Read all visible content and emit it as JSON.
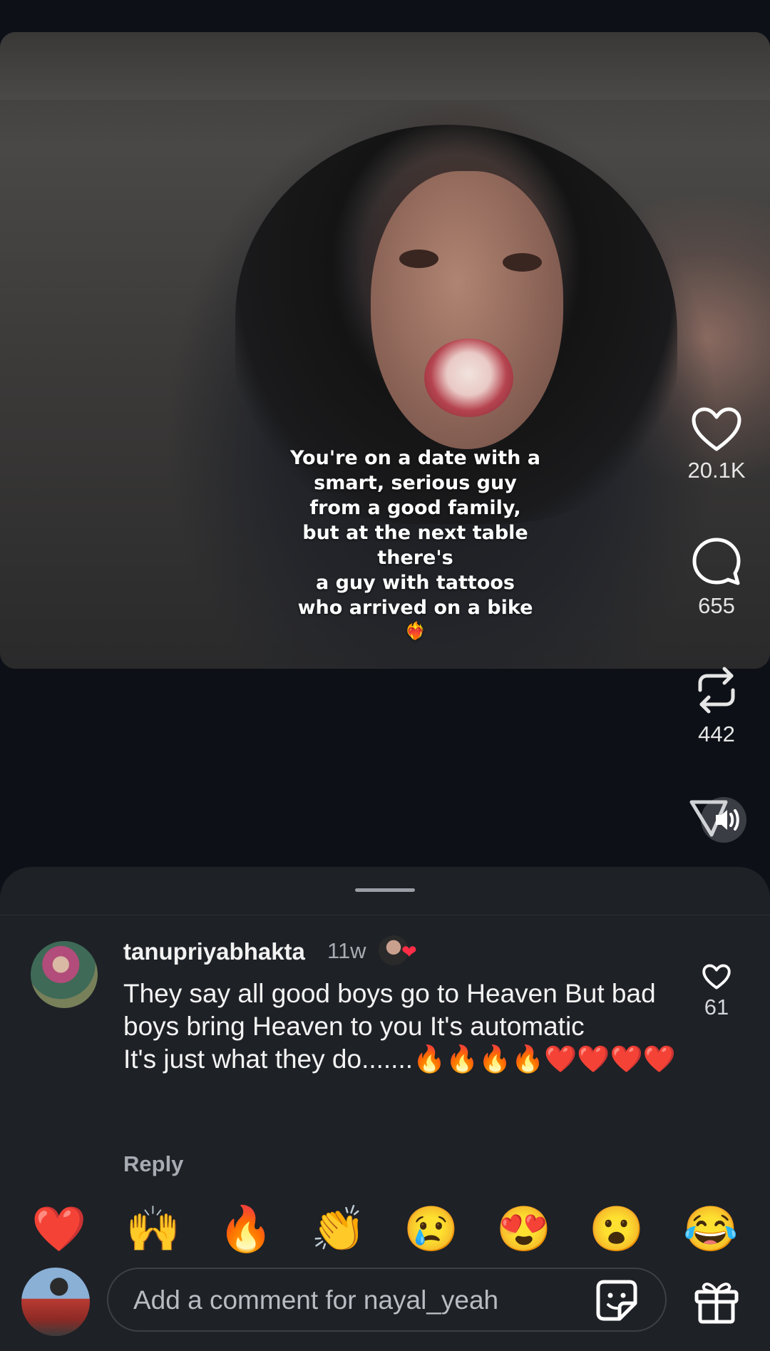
{
  "video": {
    "caption": "You're on a date with a\nsmart, serious guy\nfrom a good family,\nbut at the next table\nthere's\na guy with tattoos\nwho arrived on a bike",
    "caption_emoji": "❤️‍🔥"
  },
  "actions": {
    "likes": "20.1K",
    "comments": "655",
    "reposts": "442"
  },
  "comment": {
    "username": "tanupriyabhakta",
    "time": "11w",
    "text": "They say all good boys go to Heaven But bad boys bring Heaven to you It's automatic\nIt's just what they do.......🔥🔥🔥🔥❤️❤️❤️❤️",
    "reply_label": "Reply",
    "like_count": "61",
    "creator_heart": "❤"
  },
  "reactions": [
    "❤️",
    "🙌",
    "🔥",
    "👏",
    "😢",
    "😍",
    "😮",
    "😂"
  ],
  "composer": {
    "placeholder": "Add a comment for nayal_yeah"
  },
  "colors": {
    "background": "#0d1117",
    "sheet": "#1e2126",
    "accent_heart": "#ff2d46"
  }
}
